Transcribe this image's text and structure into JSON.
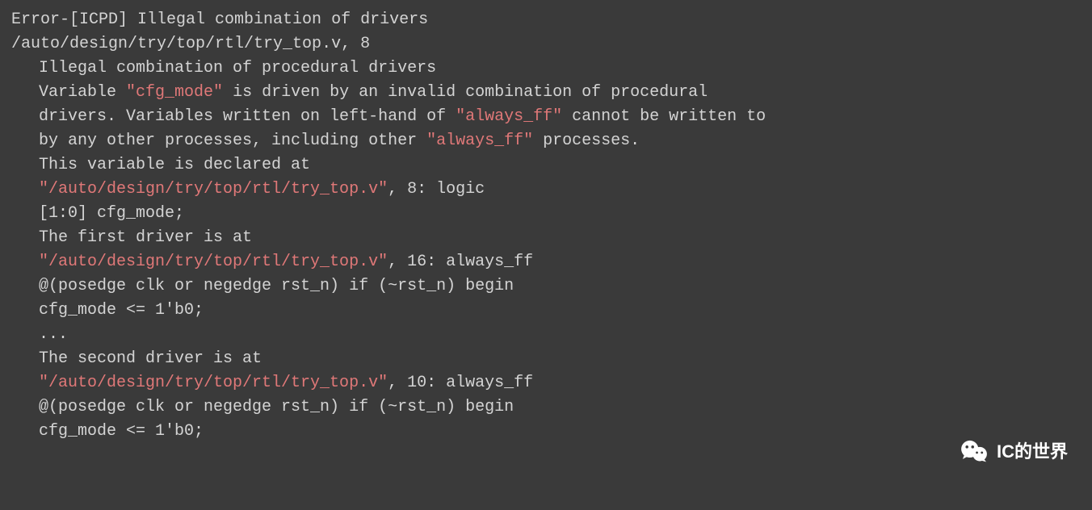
{
  "error": {
    "header": "Error-[ICPD] Illegal combination of drivers",
    "file_line": "/auto/design/try/top/rtl/try_top.v, 8",
    "reason": "Illegal combination of procedural drivers",
    "variable_pre": "Variable ",
    "variable_name": "\"cfg_mode\"",
    "variable_post": " is driven by an invalid combination of procedural",
    "drivers_pre": "drivers. Variables written on left-hand of ",
    "always_ff_1": "\"always_ff\"",
    "drivers_post": " cannot be written to",
    "by_other_pre": "by any other processes, including other ",
    "always_ff_2": "\"always_ff\"",
    "by_other_post": " processes.",
    "declared_at": "This variable is declared at",
    "decl_path": "\"/auto/design/try/top/rtl/try_top.v\"",
    "decl_post": ", 8: logic",
    "decl_bits": "[1:0] cfg_mode;",
    "first_driver": "The first driver is at",
    "first_path": "\"/auto/design/try/top/rtl/try_top.v\"",
    "first_post": ", 16: always_ff",
    "first_stmt": "@(posedge clk or negedge rst_n) if (~rst_n) begin",
    "first_assign": "cfg_mode <= 1'b0;",
    "ellipsis": "...",
    "second_driver": "The second driver is at",
    "second_path": "\"/auto/design/try/top/rtl/try_top.v\"",
    "second_post": ", 10: always_ff",
    "second_stmt": "@(posedge clk or negedge rst_n) if (~rst_n) begin",
    "second_assign": "cfg_mode <= 1'b0;"
  },
  "watermark": {
    "text": "IC的世界"
  }
}
